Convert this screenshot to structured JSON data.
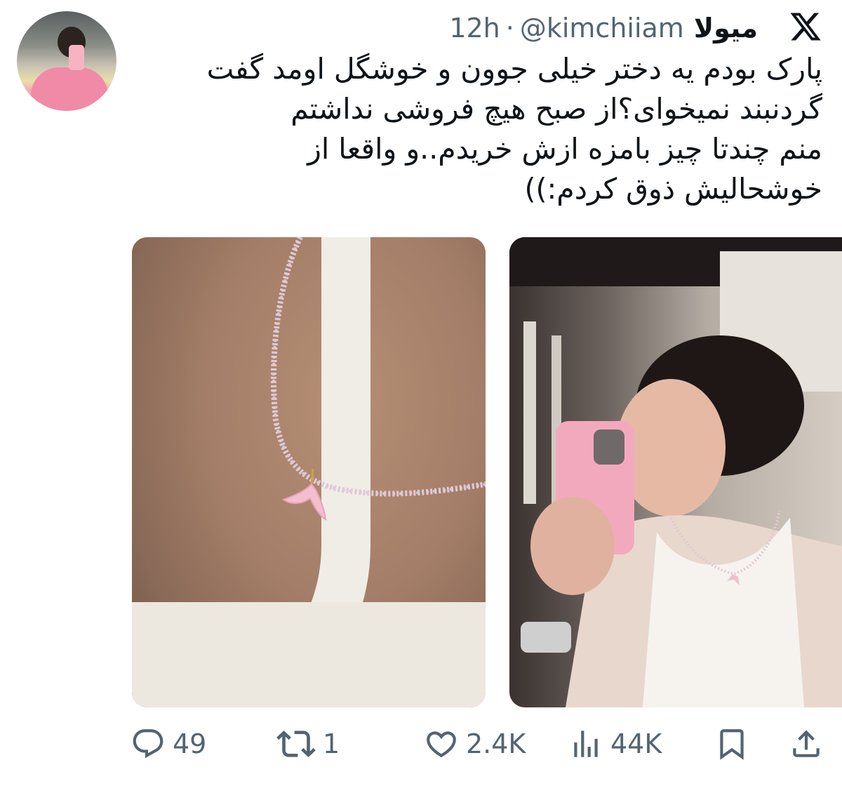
{
  "user": {
    "display_name": "میولا",
    "handle": "@kimchiiam",
    "separator": "·",
    "time": "12h"
  },
  "brand": {
    "icon": "x-logo-icon"
  },
  "tweet": {
    "lines": [
      "پارک بودم یه دختر خیلی جوون و خوشگل اومد گفت",
      "گردنبند نمیخوای؟از صبح هیچ فروشی نداشتم",
      "منم چندتا چیز بامزه ازش خریدم..و واقعا از",
      "خوشحالیش ذوق کردم:))"
    ]
  },
  "media": [
    {
      "icon": "photo-necklace-closeup"
    },
    {
      "icon": "photo-mirror-selfie"
    }
  ],
  "actions": {
    "reply": {
      "icon": "reply-icon",
      "count": "49"
    },
    "retweet": {
      "icon": "retweet-icon",
      "count": "1"
    },
    "like": {
      "icon": "heart-icon",
      "count": "2.4K"
    },
    "views": {
      "icon": "views-icon",
      "count": "44K"
    },
    "bookmark": {
      "icon": "bookmark-icon"
    },
    "share": {
      "icon": "share-icon"
    }
  },
  "colors": {
    "text": "#0f1419",
    "muted": "#536471",
    "background": "#ffffff"
  }
}
